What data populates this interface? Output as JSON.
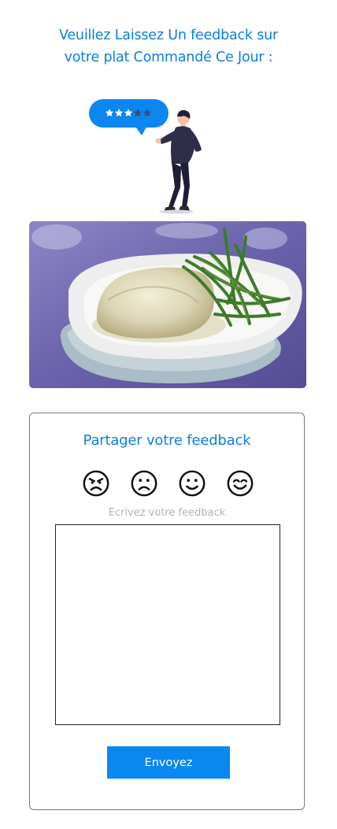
{
  "header": {
    "line1": "Veuillez Laissez Un feedback sur",
    "line2": "votre plat Commandé Ce Jour :"
  },
  "illustration": {
    "icon": "review-person-icon",
    "bubble_stars_filled": 3,
    "bubble_stars_total": 5
  },
  "photo": {
    "icon": "food-plate-photo"
  },
  "feedback": {
    "title": "Partager votre feedback",
    "emojis": [
      "angry-face-icon",
      "frowning-face-icon",
      "smiling-face-icon",
      "happy-face-icon"
    ],
    "textarea_label": "Ecrivez votre feedback",
    "textarea_value": "",
    "submit_label": "Envoyez"
  },
  "colors": {
    "accent": "#0a7fe0",
    "button": "#0a87f0",
    "label": "#b3b3b3"
  }
}
